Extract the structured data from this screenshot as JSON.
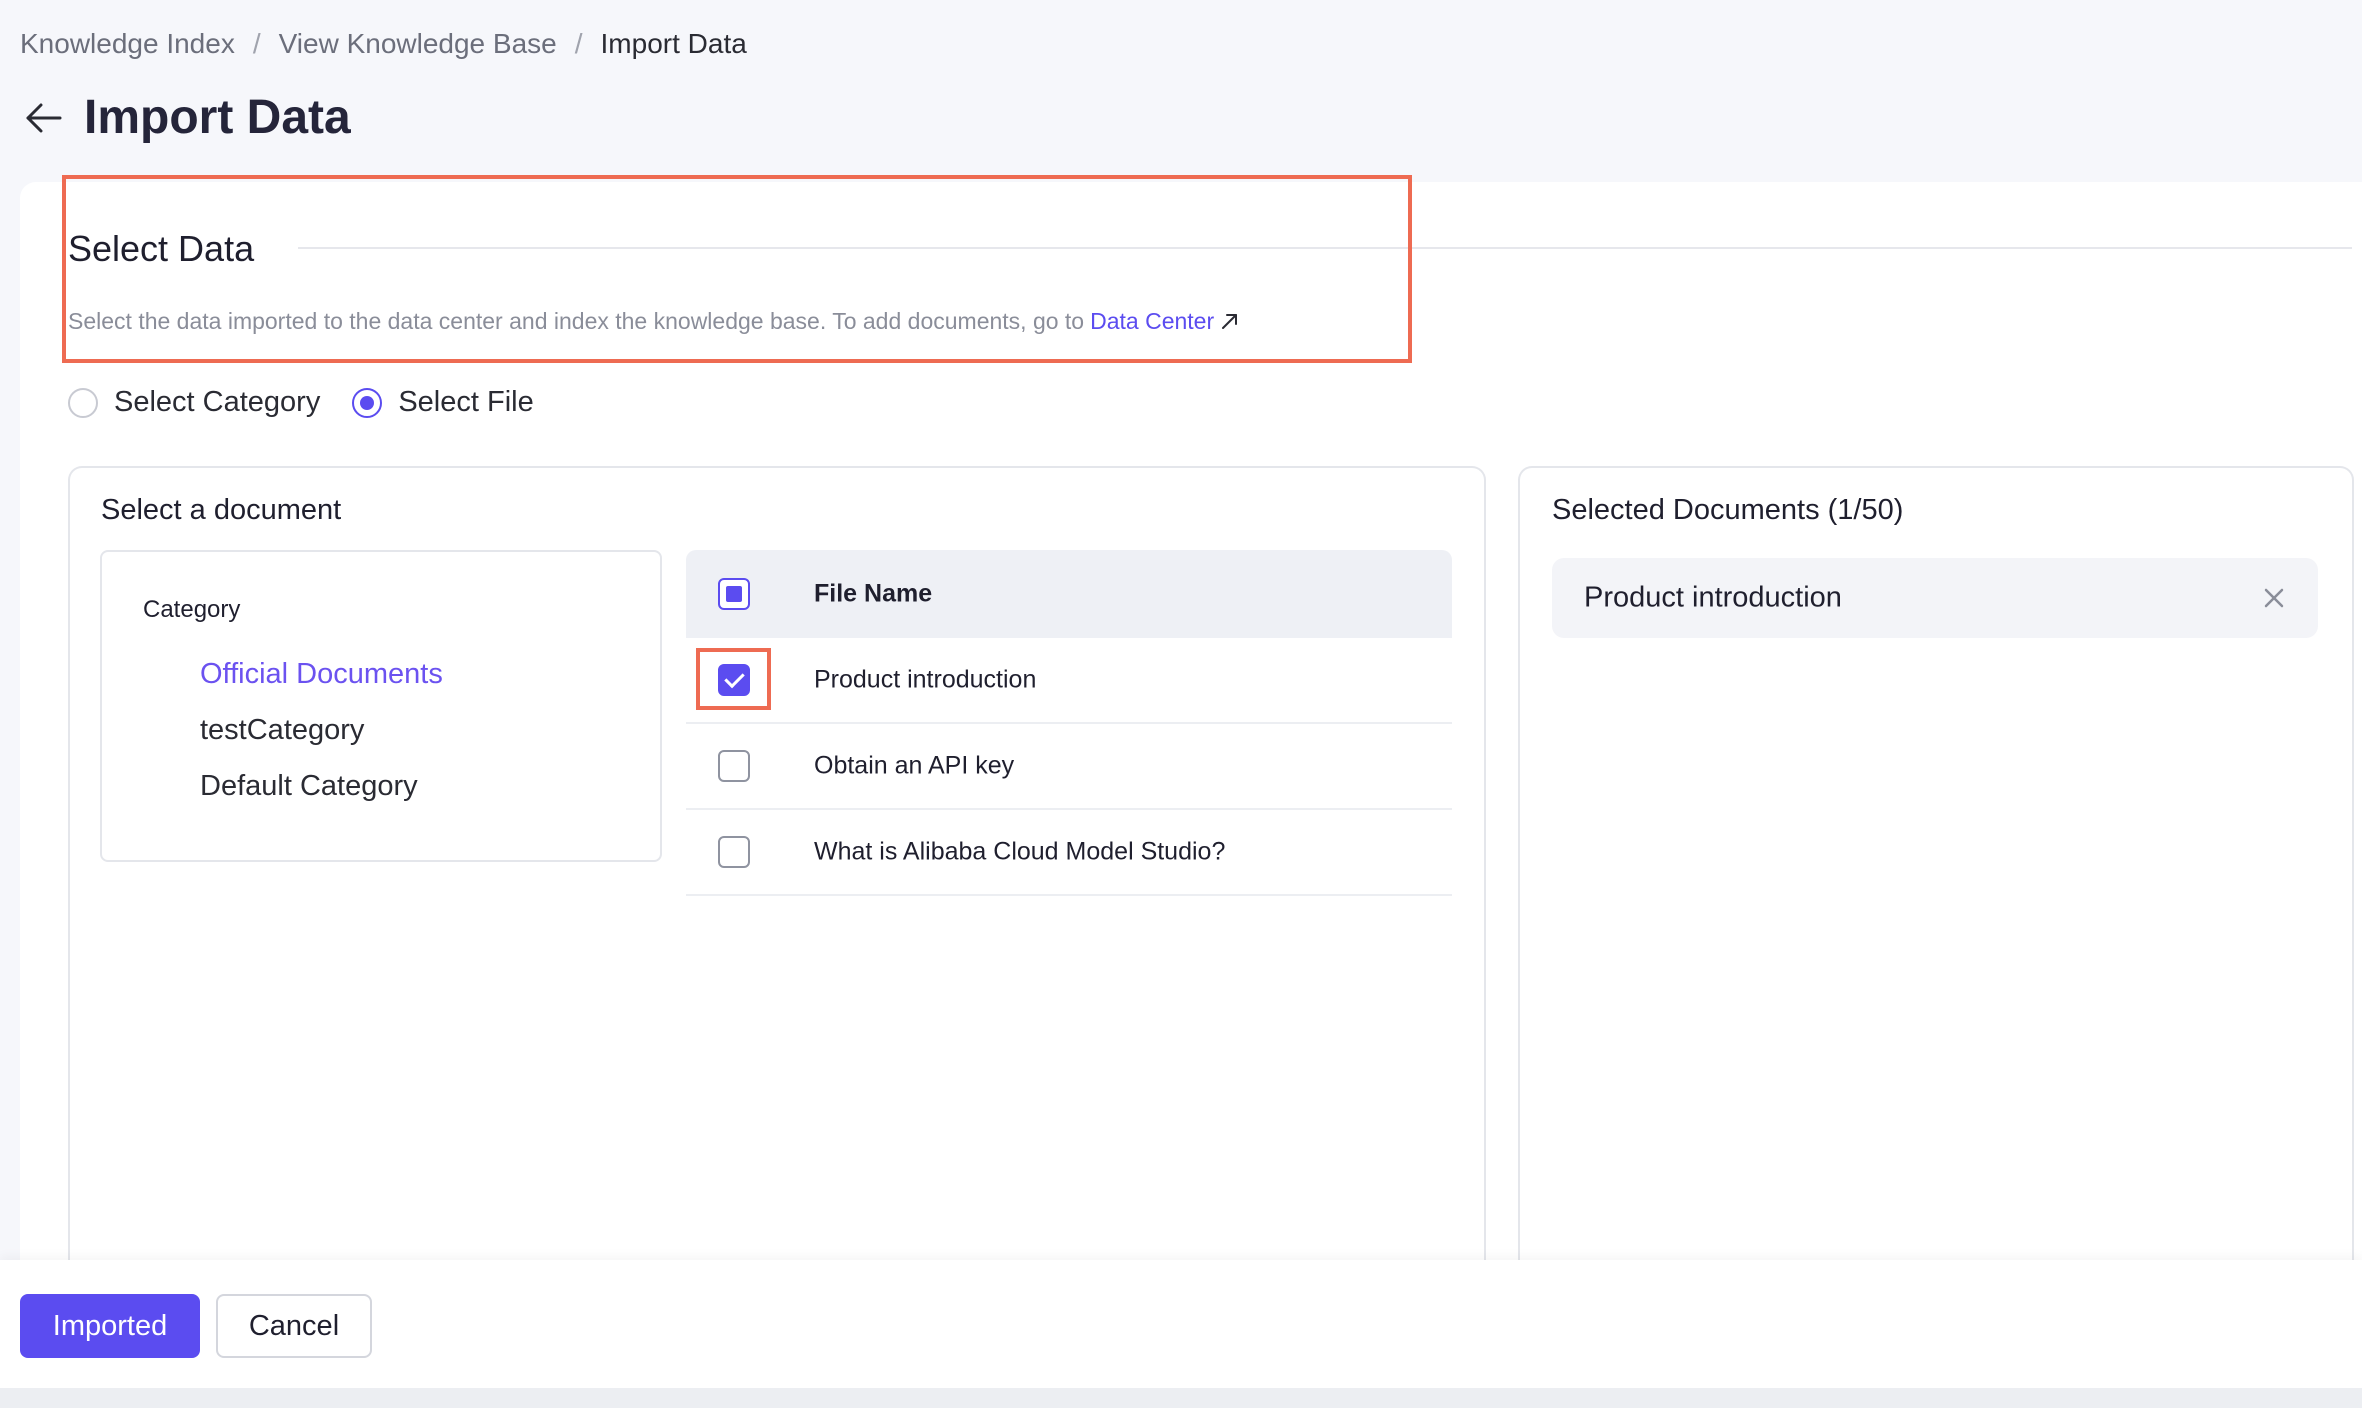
{
  "breadcrumb": {
    "items": [
      "Knowledge Index",
      "View Knowledge Base",
      "Import Data"
    ],
    "separator": "/"
  },
  "page": {
    "title": "Import Data",
    "back_icon": "arrow-left-icon"
  },
  "select_data": {
    "title": "Select Data",
    "description": "Select the data imported to the data center and index the knowledge base. To add documents, go to",
    "link_text": "Data Center",
    "link_icon": "external-link-icon"
  },
  "mode": {
    "options": [
      "Select Category",
      "Select File"
    ],
    "selected": "Select File"
  },
  "document_panel": {
    "title": "Select a document",
    "category_heading": "Category",
    "categories": [
      "Official Documents",
      "testCategory",
      "Default Category"
    ],
    "active_category": "Official Documents",
    "table_header": "File Name",
    "header_checkbox_state": "indeterminate",
    "files": [
      {
        "name": "Product introduction",
        "checked": true
      },
      {
        "name": "Obtain an API key",
        "checked": false
      },
      {
        "name": "What is Alibaba Cloud Model Studio?",
        "checked": false
      }
    ]
  },
  "selected_panel": {
    "title": "Selected Documents (1/50)",
    "items": [
      "Product introduction"
    ],
    "remove_icon": "close-icon"
  },
  "footer": {
    "primary_label": "Imported",
    "cancel_label": "Cancel"
  },
  "colors": {
    "accent": "#5b4cf0",
    "highlight": "#ee6b52",
    "muted_text": "#8a8d99"
  }
}
